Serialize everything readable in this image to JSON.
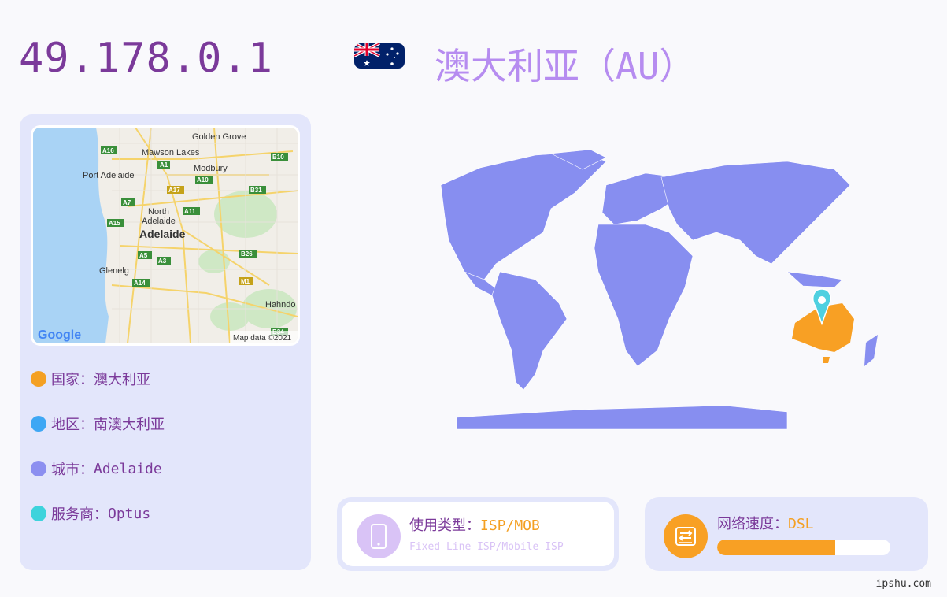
{
  "ip": "49.178.0.1",
  "country_title": "澳大利亚（AU）",
  "flag": {
    "name": "australia-flag",
    "colors": [
      "#012169",
      "#ffffff",
      "#e4002b"
    ]
  },
  "map": {
    "labels": {
      "golden_grove": "Golden Grove",
      "mawson_lakes": "Mawson Lakes",
      "port_adelaide": "Port Adelaide",
      "modbury": "Modbury",
      "north_adelaide": "North\nAdelaide",
      "adelaide": "Adelaide",
      "glenelg": "Glenelg",
      "hahndorf": "Hahndo",
      "google": "Google",
      "map_data": "Map data ©2021"
    },
    "road_shields": [
      "A16",
      "A1",
      "B10",
      "A10",
      "A17",
      "B31",
      "A7",
      "A11",
      "A15",
      "A5",
      "A3",
      "B26",
      "A14",
      "M1",
      "B34"
    ]
  },
  "info": {
    "country": {
      "label": "国家：",
      "value": "澳大利亚",
      "color": "#f4a023"
    },
    "region": {
      "label": "地区：",
      "value": "南澳大利亚",
      "color": "#3ea7f4"
    },
    "city": {
      "label": "城市：",
      "value": "Adelaide",
      "color": "#8c8ff0"
    },
    "isp": {
      "label": "服务商：",
      "value": "Optus",
      "color": "#3dd3dc"
    }
  },
  "usage": {
    "label": "使用类型：",
    "value": "ISP/MOB",
    "sub": "Fixed Line ISP/Mobile ISP",
    "icon": "phone-icon"
  },
  "speed": {
    "label": "网络速度：",
    "value": "DSL",
    "level_fraction": 0.68,
    "icon": "network-speed-icon"
  },
  "colors": {
    "world": "#878ef0",
    "highlight": "#f8a024",
    "pin": "#4fd0e0"
  },
  "watermark": "ipshu.com"
}
